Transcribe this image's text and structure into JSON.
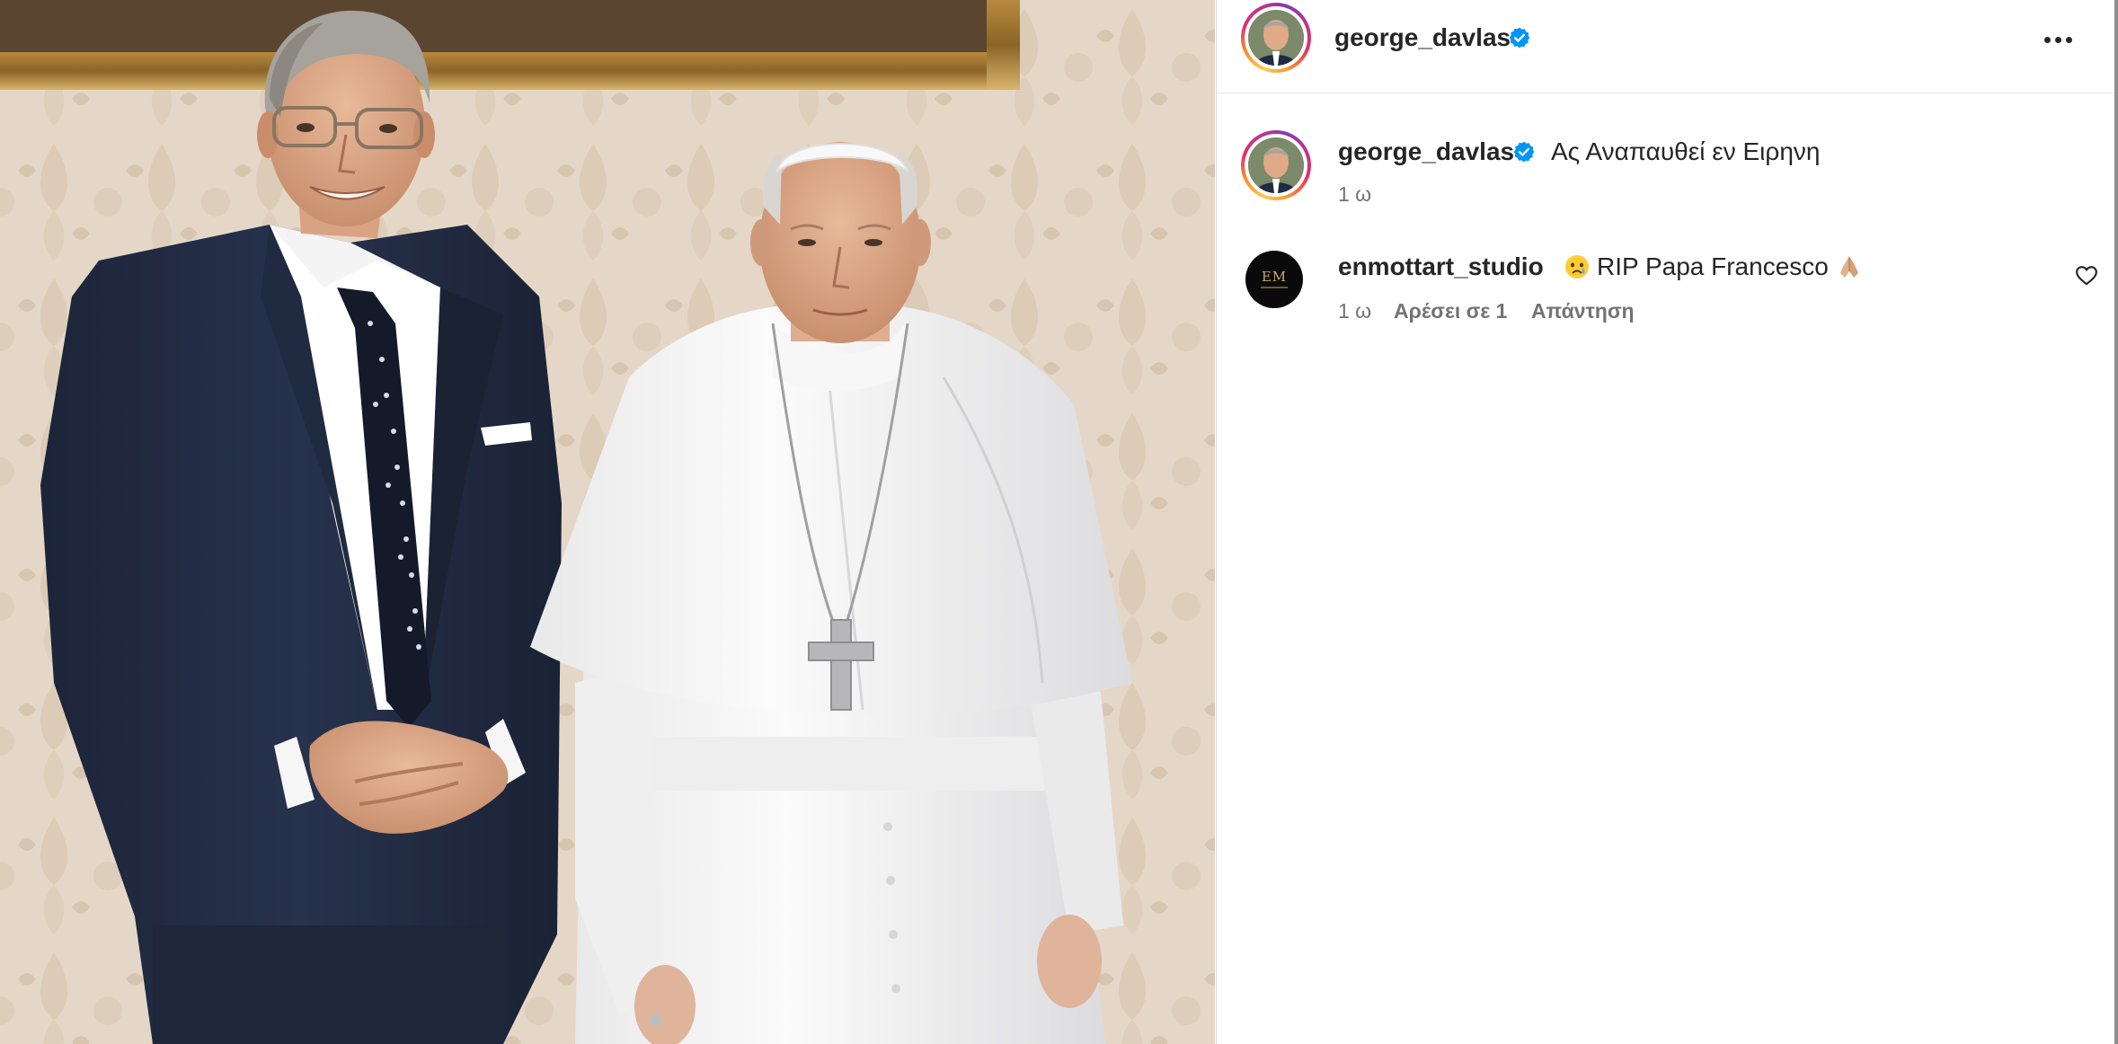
{
  "post": {
    "author": "george_davlas",
    "caption": "Ας Αναπαυθεί εν Ειρηνη",
    "caption_time": "1 ω"
  },
  "comments": [
    {
      "username": "enmottart_studio",
      "avatar_text": "EM",
      "text_before_emoji": "RIP Papa Francesco",
      "time": "1 ω",
      "likes": "Αρέσει σε 1",
      "reply": "Απάντηση"
    }
  ],
  "icons": {
    "verified": "verified-badge-icon",
    "more": "more-options-icon",
    "like": "heart-icon",
    "emoji_sad": "crying-face-emoji",
    "emoji_pray": "folded-hands-emoji"
  },
  "colors": {
    "verified_blue": "#0095f6",
    "text_primary": "#262626",
    "text_secondary": "#737373"
  }
}
